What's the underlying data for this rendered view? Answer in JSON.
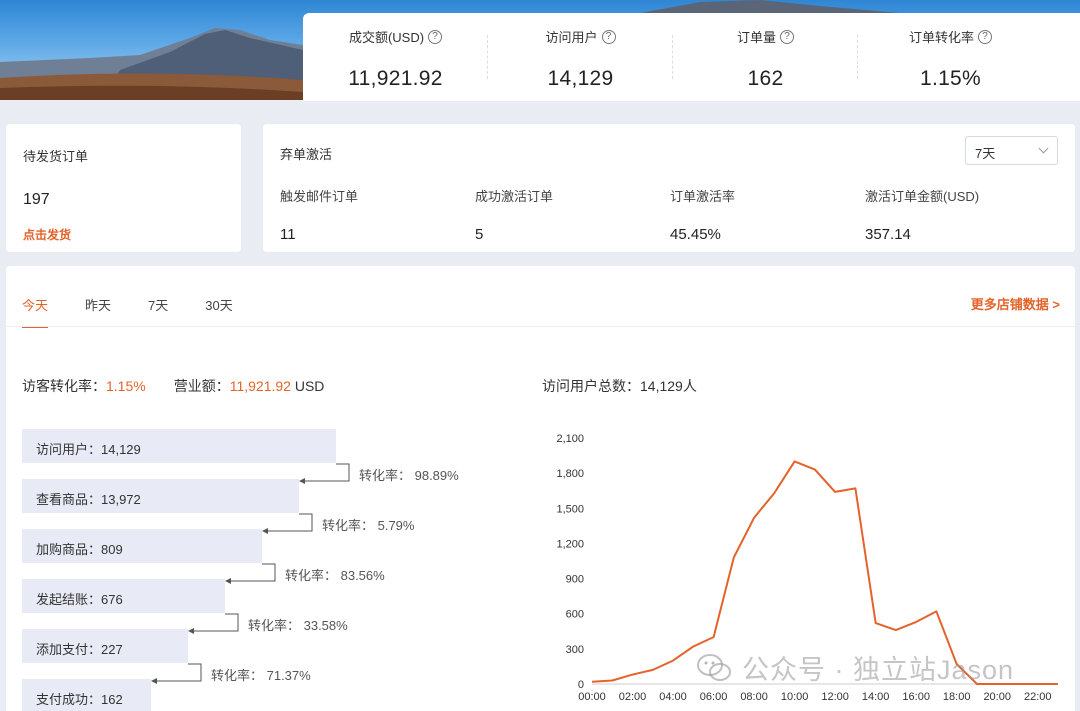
{
  "kpis": [
    {
      "label": "成交额(USD)",
      "value": "11,921.92"
    },
    {
      "label": "访问用户",
      "value": "14,129"
    },
    {
      "label": "订单量",
      "value": "162"
    },
    {
      "label": "订单转化率",
      "value": "1.15%"
    }
  ],
  "pending": {
    "title": "待发货订单",
    "count": "197",
    "action": "点击发货"
  },
  "abandon": {
    "title": "弃单激活",
    "range": "7天",
    "metrics": [
      {
        "label": "触发邮件订单",
        "value": "11"
      },
      {
        "label": "成功激活订单",
        "value": "5"
      },
      {
        "label": "订单激活率",
        "value": "45.45%"
      },
      {
        "label": "激活订单金额(USD)",
        "value": "357.14"
      }
    ]
  },
  "tabs": [
    "今天",
    "昨天",
    "7天",
    "30天"
  ],
  "more_link": "更多店铺数据 >",
  "summary": {
    "conversion_label": "访客转化率：",
    "conversion_value": "1.15%",
    "revenue_label": "营业额：",
    "revenue_value": "11,921.92",
    "revenue_unit": " USD",
    "visitors_total": "访问用户总数：14,129人"
  },
  "funnel": [
    {
      "label": "访问用户：14,129",
      "value": 14129
    },
    {
      "label": "查看商品：13,972",
      "value": 13972
    },
    {
      "label": "加购商品：809",
      "value": 809
    },
    {
      "label": "发起结账：676",
      "value": 676
    },
    {
      "label": "添加支付：227",
      "value": 227
    },
    {
      "label": "支付成功：162",
      "value": 162
    }
  ],
  "funnel_rates": [
    "转化率： 98.89%",
    "转化率： 5.79%",
    "转化率： 83.56%",
    "转化率： 33.58%",
    "转化率： 71.37%"
  ],
  "watermark": "公众号 · 独立站Jason",
  "colors": {
    "accent": "#e4632a",
    "funnel_bar": "#e8ebf5"
  },
  "chart_data": {
    "type": "line",
    "x": [
      "00:00",
      "01:00",
      "02:00",
      "03:00",
      "04:00",
      "05:00",
      "06:00",
      "07:00",
      "08:00",
      "09:00",
      "10:00",
      "11:00",
      "12:00",
      "13:00",
      "14:00",
      "15:00",
      "16:00",
      "17:00",
      "18:00",
      "19:00",
      "20:00",
      "21:00",
      "22:00",
      "23:00"
    ],
    "x_tick_labels": [
      "00:00",
      "02:00",
      "04:00",
      "06:00",
      "08:00",
      "10:00",
      "12:00",
      "14:00",
      "16:00",
      "18:00",
      "20:00",
      "22:00"
    ],
    "y_tick_labels": [
      "0",
      "300",
      "600",
      "900",
      "1,200",
      "1,500",
      "1,800",
      "2,100"
    ],
    "series": [
      {
        "values": [
          20,
          30,
          80,
          120,
          200,
          320,
          400,
          1080,
          1420,
          1630,
          1900,
          1830,
          1640,
          1670,
          520,
          460,
          530,
          620,
          170,
          0,
          0,
          0,
          0,
          0
        ]
      }
    ],
    "ylim": [
      0,
      2100
    ],
    "grid": false
  }
}
